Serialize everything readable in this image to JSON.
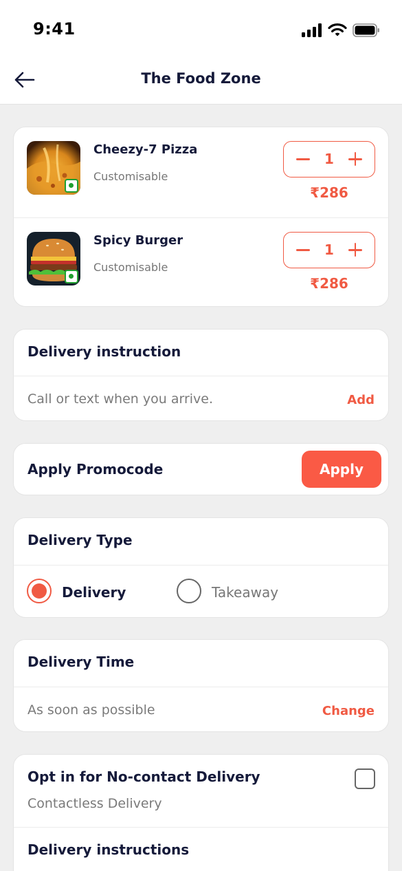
{
  "status_bar": {
    "time": "9:41"
  },
  "header": {
    "title": "The Food Zone"
  },
  "cart": {
    "items": [
      {
        "name": "Cheezy-7 Pizza",
        "subtitle": "Customisable",
        "quantity": "1",
        "price": "₹286",
        "image": "pizza"
      },
      {
        "name": "Spicy Burger",
        "subtitle": "Customisable",
        "quantity": "1",
        "price": "₹286",
        "image": "burger"
      }
    ]
  },
  "delivery_instruction": {
    "title": "Delivery instruction",
    "placeholder": "Call or text when you arrive.",
    "action": "Add"
  },
  "promocode": {
    "label": "Apply Promocode",
    "button": "Apply"
  },
  "delivery_type": {
    "title": "Delivery Type",
    "options": [
      {
        "label": "Delivery",
        "selected": true
      },
      {
        "label": "Takeaway",
        "selected": false
      }
    ]
  },
  "delivery_time": {
    "title": "Delivery Time",
    "value": "As soon as possible",
    "action": "Change"
  },
  "no_contact": {
    "title": "Opt in for No-contact Delivery",
    "subtitle": "Contactless Delivery",
    "checked": false,
    "instructions_title": "Delivery instructions"
  },
  "colors": {
    "accent": "#f05a43",
    "text": "#151a3a",
    "background": "#efefef",
    "veg": "#1f9f2f"
  }
}
